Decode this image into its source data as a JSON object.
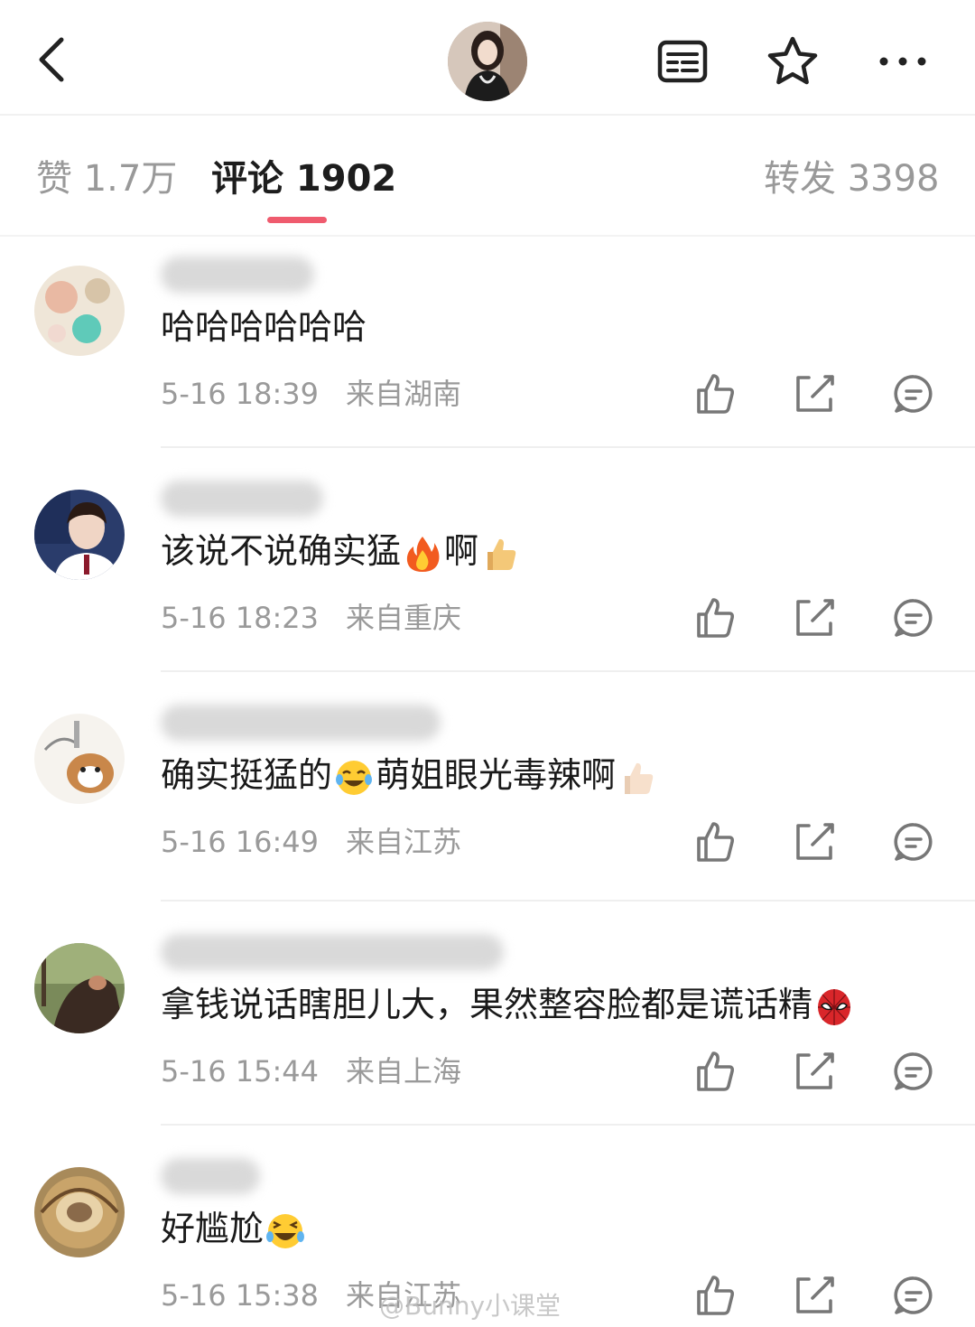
{
  "header": {
    "back_icon": "chevron-left-icon",
    "menu_icon": "document-list-icon",
    "star_icon": "star-outline-icon",
    "more_icon": "more-dots-icon"
  },
  "tabs": [
    {
      "label": "赞 1.7万"
    },
    {
      "label": "评论 1902"
    },
    {
      "label": "转发 3398"
    }
  ],
  "accent_color": "#ef5b6e",
  "comments": [
    {
      "text": "哈哈哈哈哈哈",
      "time": "5-16 18:39",
      "location": "来自湖南",
      "avatar_style": "floral"
    },
    {
      "text_before": "该说不说确实猛",
      "text_middle": "啊",
      "time": "5-16 18:23",
      "location": "来自重庆",
      "emojis": [
        "fire",
        "thumbs-up"
      ]
    },
    {
      "text_before": "确实挺猛的",
      "text_middle": "萌姐眼光毒辣啊",
      "time": "5-16 16:49",
      "location": "来自江苏",
      "emojis": [
        "tears-of-joy",
        "thumbs-up"
      ]
    },
    {
      "text_before": "拿钱说话瞎胆儿大，果然整容脸都是谎话精",
      "time": "5-16 15:44",
      "location": "来自上海",
      "emojis": [
        "spider-mask"
      ]
    },
    {
      "text_before": "好尴尬",
      "time": "5-16 15:38",
      "location": "来自江苏",
      "emojis": [
        "laughing"
      ]
    }
  ],
  "action_icons": [
    "like-icon",
    "share-icon",
    "reply-icon"
  ],
  "watermark": "@Bunny小课堂"
}
